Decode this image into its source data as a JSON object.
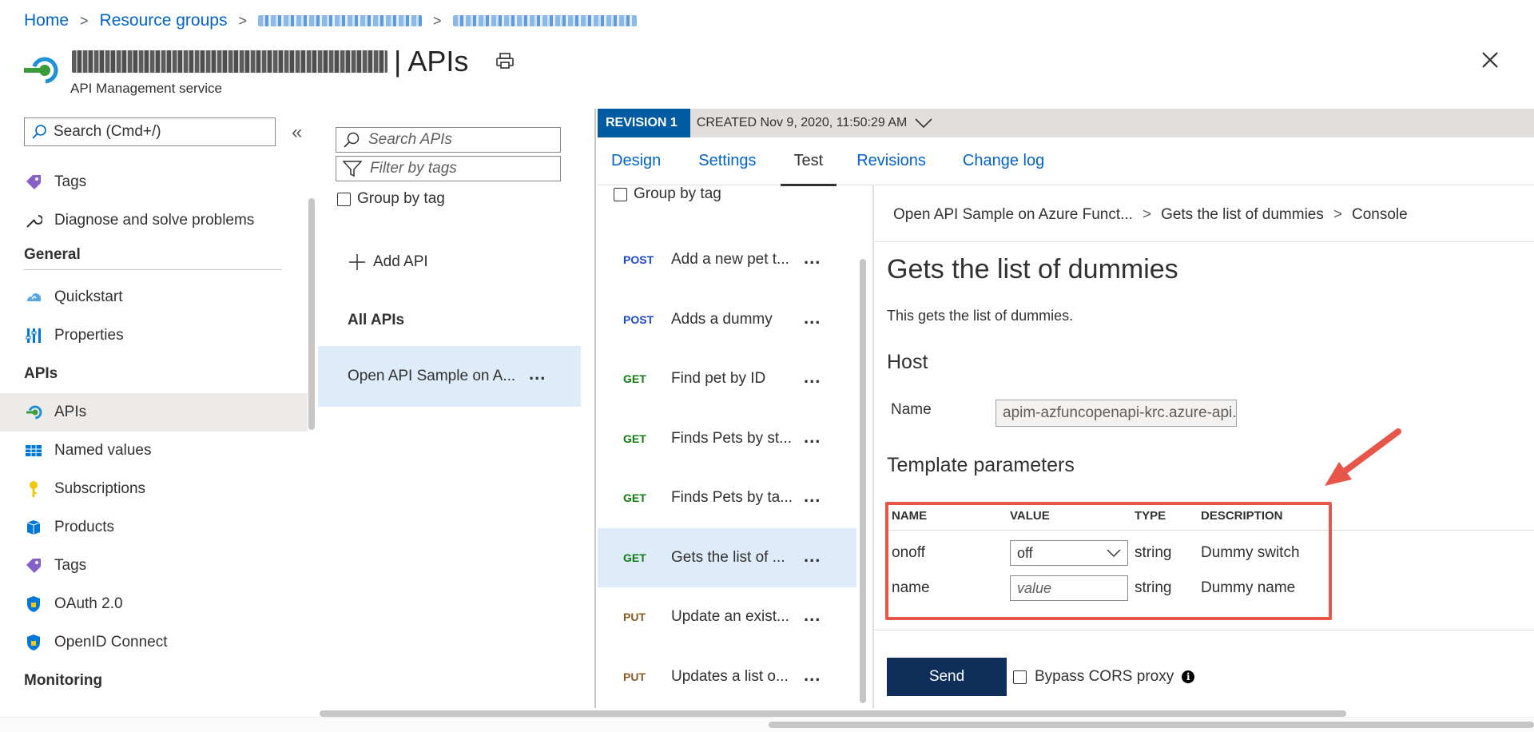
{
  "breadcrumb": {
    "home": "Home",
    "resource_groups": "Resource groups",
    "sep": ">"
  },
  "header": {
    "title_suffix": "| APIs",
    "subtitle": "API Management service"
  },
  "nav": {
    "search_placeholder": "Search (Cmd+/)",
    "collapse": "«",
    "items_top": [
      {
        "label": "Tags",
        "icon": "tag-icon"
      },
      {
        "label": "Diagnose and solve problems",
        "icon": "wrench-icon"
      }
    ],
    "general_heading": "General",
    "general_items": [
      {
        "label": "Quickstart",
        "icon": "cloud-icon"
      },
      {
        "label": "Properties",
        "icon": "properties-icon"
      }
    ],
    "apis_heading": "APIs",
    "apis_items": [
      {
        "label": "APIs",
        "icon": "api-icon"
      },
      {
        "label": "Named values",
        "icon": "table-icon"
      },
      {
        "label": "Subscriptions",
        "icon": "key-icon"
      },
      {
        "label": "Products",
        "icon": "box-icon"
      },
      {
        "label": "Tags",
        "icon": "tag-icon"
      },
      {
        "label": "OAuth 2.0",
        "icon": "shield-icon"
      },
      {
        "label": "OpenID Connect",
        "icon": "shield-icon"
      }
    ],
    "monitoring_heading": "Monitoring"
  },
  "api_list": {
    "search_placeholder": "Search APIs",
    "filter_placeholder": "Filter by tags",
    "group_by_tag": "Group by tag",
    "add_api": "Add API",
    "all_apis": "All APIs",
    "selected_api": "Open API Sample on A...",
    "more": "..."
  },
  "revision": {
    "badge": "REVISION 1",
    "created": "CREATED Nov 9, 2020, 11:50:29 AM"
  },
  "tabs": [
    "Design",
    "Settings",
    "Test",
    "Revisions",
    "Change log"
  ],
  "operations": {
    "group_by_tag": "Group by tag",
    "items": [
      {
        "verb": "POST",
        "name": "Add a new pet t..."
      },
      {
        "verb": "POST",
        "name": "Adds a dummy"
      },
      {
        "verb": "GET",
        "name": "Find pet by ID"
      },
      {
        "verb": "GET",
        "name": "Finds Pets by st..."
      },
      {
        "verb": "GET",
        "name": "Finds Pets by ta..."
      },
      {
        "verb": "GET",
        "name": "Gets the list of ..."
      },
      {
        "verb": "PUT",
        "name": "Update an exist..."
      },
      {
        "verb": "PUT",
        "name": "Updates a list o..."
      }
    ]
  },
  "console": {
    "bread_api": "Open API Sample on Azure Funct...",
    "bread_op": "Gets the list of dummies",
    "bread_console": "Console",
    "title": "Gets the list of dummies",
    "description": "This gets the list of dummies.",
    "host_heading": "Host",
    "host_name_label": "Name",
    "host_value": "apim-azfuncopenapi-krc.azure-api.net",
    "template_heading": "Template parameters",
    "columns": {
      "name": "NAME",
      "value": "VALUE",
      "type": "TYPE",
      "description": "DESCRIPTION"
    },
    "params": [
      {
        "name": "onoff",
        "value": "off",
        "type": "string",
        "description": "Dummy switch"
      },
      {
        "name": "name",
        "placeholder": "value",
        "type": "string",
        "description": "Dummy name"
      }
    ],
    "send": "Send",
    "bypass_cors": "Bypass CORS proxy"
  },
  "colors": {
    "accent": "#0064c8",
    "revision_badge": "#005ba1",
    "send_button": "#0f2e5a",
    "highlight_box": "#e8564a",
    "selected_row": "#deecf9"
  }
}
